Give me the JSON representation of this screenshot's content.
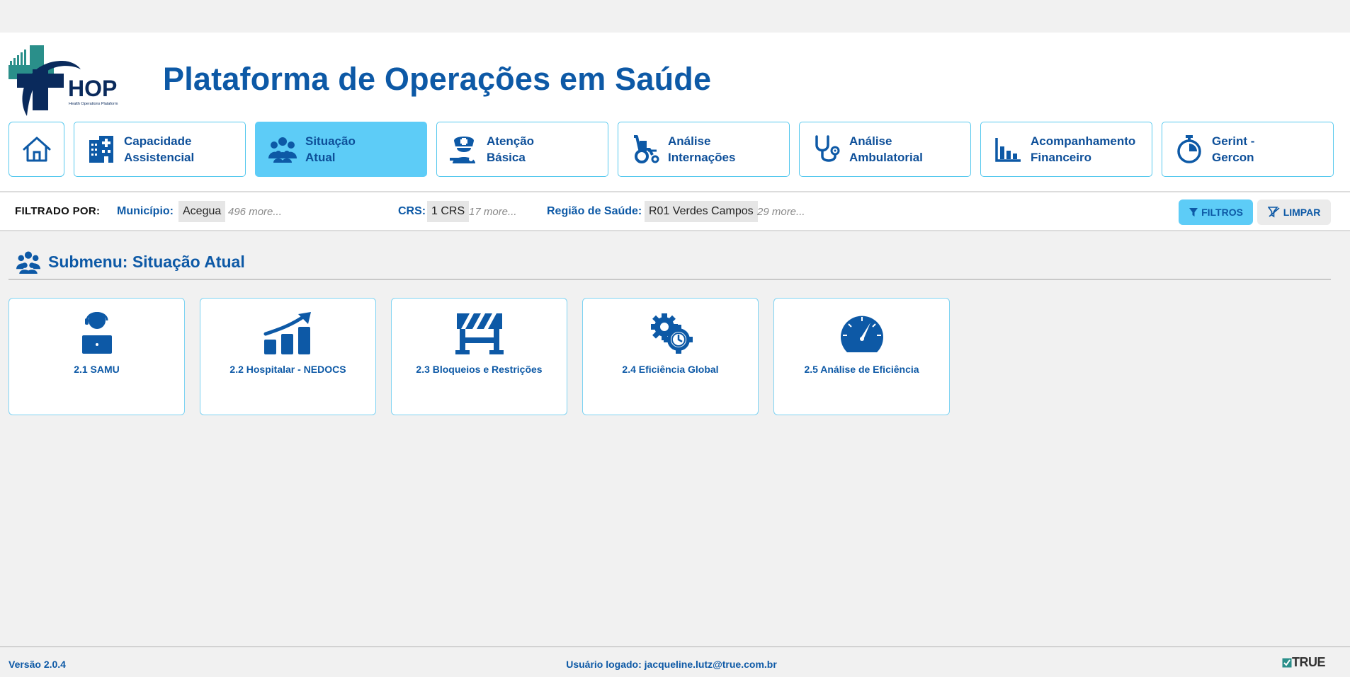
{
  "app": {
    "title": "Plataforma de Operações em Saúde",
    "logo_text": "HOP",
    "logo_subtitle": "Health Operations Plataform"
  },
  "nav": {
    "items": [
      {
        "label_line1": "Capacidade",
        "label_line2": "Assistencial",
        "icon": "hospital-icon"
      },
      {
        "label_line1": "Situação",
        "label_line2": "Atual",
        "icon": "people-group-icon",
        "active": true
      },
      {
        "label_line1": "Atenção",
        "label_line2": "Básica",
        "icon": "nurse-icon"
      },
      {
        "label_line1": "Análise",
        "label_line2": "Internações",
        "icon": "wheelchair-icon"
      },
      {
        "label_line1": "Análise",
        "label_line2": "Ambulatorial",
        "icon": "stethoscope-icon"
      },
      {
        "label_line1": "Acompanhamento",
        "label_line2": "Financeiro",
        "icon": "bar-chart-icon"
      },
      {
        "label_line1": "Gerint -",
        "label_line2": "Gercon",
        "icon": "stopwatch-icon"
      }
    ]
  },
  "filters": {
    "title": "FILTRADO POR:",
    "municipio_label": "Município:",
    "municipio_value": "Acegua",
    "municipio_more": "496 more...",
    "crs_label": "CRS:",
    "crs_value": "1 CRS",
    "crs_more": "17 more...",
    "regiao_label": "Região de Saúde:",
    "regiao_value": "R01 Verdes Campos",
    "regiao_more": "29 more...",
    "filtros_button": "FILTROS",
    "limpar_button": "LIMPAR"
  },
  "submenu": {
    "title": "Submenu: Situação Atual",
    "cards": [
      {
        "label": "2.1 SAMU",
        "icon": "operator-laptop-icon"
      },
      {
        "label": "2.2 Hospitalar - NEDOCS",
        "icon": "growth-chart-icon"
      },
      {
        "label": "2.3 Bloqueios e Restrições",
        "icon": "barrier-icon"
      },
      {
        "label": "2.4 Eficiência Global",
        "icon": "gears-clock-icon"
      },
      {
        "label": "2.5 Análise de Eficiência",
        "icon": "speedometer-icon"
      }
    ]
  },
  "footer": {
    "version": "Versão 2.0.4",
    "user": "Usuário logado: jacqueline.lutz@true.com.br",
    "brand": "TRUE"
  },
  "colors": {
    "primary": "#0d59a6",
    "accent": "#5dccf7",
    "border": "#58c9ee",
    "teal": "#2a8f8a",
    "navy": "#0a2a5c"
  }
}
